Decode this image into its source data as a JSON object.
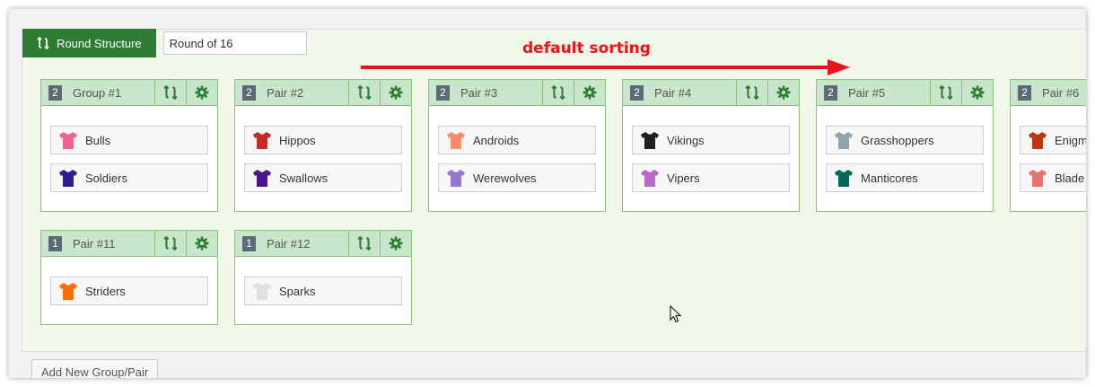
{
  "toolbar": {
    "round_structure_label": "Round Structure",
    "round_input_value": "Round of 16"
  },
  "annotation": {
    "text": "default sorting",
    "color": "#e8141b"
  },
  "colors": {
    "primary_green": "#2e7d32",
    "card_header": "#c8e6c9",
    "card_border": "#8bc37b",
    "panel_bg": "#f1f8ea",
    "badge_bg": "#5c6b73"
  },
  "cards": [
    {
      "badge": "2",
      "title": "Group #1",
      "teams": [
        {
          "name": "Bulls",
          "color": "#f06292"
        },
        {
          "name": "Soldiers",
          "color": "#311b92"
        }
      ]
    },
    {
      "badge": "2",
      "title": "Pair #2",
      "teams": [
        {
          "name": "Hippos",
          "color": "#c62828"
        },
        {
          "name": "Swallows",
          "color": "#4a148c"
        }
      ]
    },
    {
      "badge": "2",
      "title": "Pair #3",
      "teams": [
        {
          "name": "Androids",
          "color": "#ff8a65"
        },
        {
          "name": "Werewolves",
          "color": "#9575cd"
        }
      ]
    },
    {
      "badge": "2",
      "title": "Pair #4",
      "teams": [
        {
          "name": "Vikings",
          "color": "#212121"
        },
        {
          "name": "Vipers",
          "color": "#ba68c8"
        }
      ]
    },
    {
      "badge": "2",
      "title": "Pair #5",
      "teams": [
        {
          "name": "Grasshoppers",
          "color": "#90a4ae"
        },
        {
          "name": "Manticores",
          "color": "#00695c"
        }
      ]
    },
    {
      "badge": "2",
      "title": "Pair #6",
      "teams": [
        {
          "name": "Enigm",
          "color": "#bf360c"
        },
        {
          "name": "Blade",
          "color": "#e57373"
        }
      ]
    },
    {
      "badge": "1",
      "title": "Pair #11",
      "teams": [
        {
          "name": "Striders",
          "color": "#ff6d00"
        }
      ]
    },
    {
      "badge": "1",
      "title": "Pair #12",
      "teams": [
        {
          "name": "Sparks",
          "color": "#e0e0e0"
        }
      ]
    }
  ],
  "add_button_label": "Add New Group/Pair",
  "icons": {
    "swap": "swap-icon",
    "settings": "gear-icon",
    "shirt": "shirt-icon",
    "cursor": "cursor-icon"
  }
}
